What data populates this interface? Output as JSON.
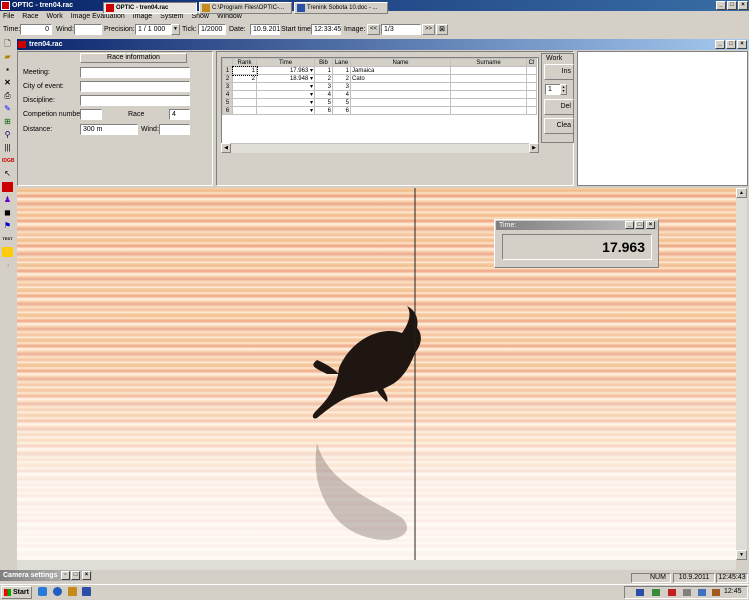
{
  "app": {
    "title": "OPTIC - tren04.rac"
  },
  "menu": [
    "File",
    "Race",
    "Work",
    "Image Evaluation",
    "Image",
    "System",
    "Show",
    "Window"
  ],
  "toolbar": {
    "time_label": "Time:",
    "time_value": "0",
    "wind_label": "Wind:",
    "wind_value": "",
    "precision_label": "Precision:",
    "precision_value": "1 / 1 000",
    "tick_label": "Tick:",
    "tick_value": "1/2000",
    "date_label": "Date:",
    "date_value": "10.9.201",
    "start_label": "Start time",
    "start_value": "12:33:45",
    "image_label": "Image:",
    "image_value": "1/3",
    "prev": "<<",
    "next": ">>"
  },
  "document": {
    "title": "tren04.rac"
  },
  "race_info": {
    "header": "Race information",
    "meeting_label": "Meeting:",
    "meeting_value": "",
    "city_label": "City of event:",
    "city_value": "",
    "discipline_label": "Discipline:",
    "discipline_value": "",
    "competition_label": "Competion number:",
    "competition_value": "",
    "race_label": "Race",
    "race_value": "4",
    "distance_label": "Distance:",
    "distance_value": "300 m",
    "wind_label": "Wind:",
    "wind_value": ""
  },
  "results": {
    "columns": [
      "Rank",
      "Time",
      "Bib",
      "Lane",
      "Name",
      "Surname",
      "Cl"
    ],
    "rows": [
      {
        "n": "1",
        "rank": "1",
        "time": "17.963",
        "bib": "1",
        "lane": "1",
        "name": "Jamaica",
        "surname": ""
      },
      {
        "n": "2",
        "rank": "2",
        "time": "18.948",
        "bib": "2",
        "lane": "2",
        "name": "Cato",
        "surname": ""
      },
      {
        "n": "3",
        "rank": "",
        "time": "",
        "bib": "3",
        "lane": "3",
        "name": "",
        "surname": ""
      },
      {
        "n": "4",
        "rank": "",
        "time": "",
        "bib": "4",
        "lane": "4",
        "name": "",
        "surname": ""
      },
      {
        "n": "5",
        "rank": "",
        "time": "",
        "bib": "5",
        "lane": "5",
        "name": "",
        "surname": ""
      },
      {
        "n": "6",
        "rank": "",
        "time": "",
        "bib": "6",
        "lane": "6",
        "name": "",
        "surname": ""
      }
    ]
  },
  "work": {
    "label": "Work",
    "insert": "Ins",
    "spinner": "1",
    "delete": "Del",
    "clear": "Clea"
  },
  "time_popup": {
    "title": "Time:",
    "value": "17.963"
  },
  "camera": {
    "title": "Camera settings"
  },
  "status": {
    "num": "NUM",
    "date": "10.9.2011",
    "time": "12:45:43"
  },
  "taskbar": {
    "start": "Start",
    "tasks": [
      "OPTIC - tren04.rac",
      "C:\\Program Files\\OPTIC-...",
      "Trenink Sobota 10.doc - ..."
    ],
    "clock": "12:45"
  },
  "colors": {
    "titlebar": "#0a246a",
    "chrome": "#d4d0c8"
  }
}
